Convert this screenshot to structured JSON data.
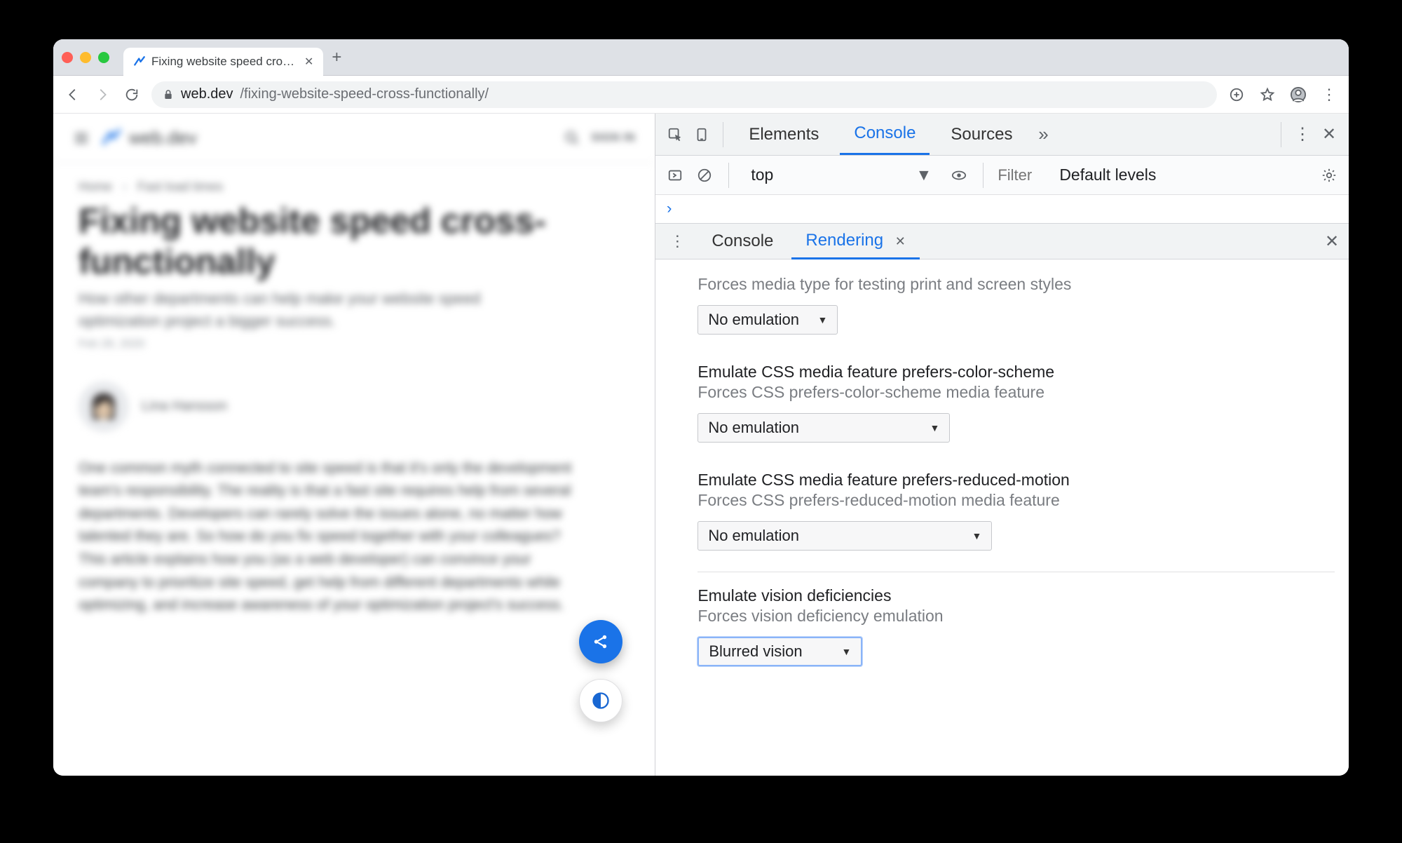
{
  "browser": {
    "tab_title": "Fixing website speed cross-fun",
    "url_host": "web.dev",
    "url_path": "/fixing-website-speed-cross-functionally/"
  },
  "page": {
    "brand": "web.dev",
    "sign_in": "SIGN IN",
    "crumbs": {
      "home": "Home",
      "section": "Fast load times"
    },
    "title": "Fixing website speed cross-functionally",
    "subtitle": "How other departments can help make your website speed optimization project a bigger success.",
    "date": "Feb 28, 2020",
    "author": "Lina Hansson",
    "body": "One common myth connected to site speed is that it's only the development team's responsibility. The reality is that a fast site requires help from several departments. Developers can rarely solve the issues alone, no matter how talented they are. So how do you fix speed together with your colleagues? This article explains how you (as a web developer) can convince your company to prioritize site speed, get help from different departments while optimizing, and increase awareness of your optimization project's success."
  },
  "devtools": {
    "tabs": {
      "elements": "Elements",
      "console": "Console",
      "sources": "Sources"
    },
    "context": "top",
    "filter_placeholder": "Filter",
    "levels": "Default levels ",
    "drawer": {
      "console": "Console",
      "rendering": "Rendering"
    },
    "rendering": {
      "media_type_desc": "Forces media type for testing print and screen styles",
      "no_emulation": "No emulation",
      "color_scheme_label": "Emulate CSS media feature prefers-color-scheme",
      "color_scheme_desc": "Forces CSS prefers-color-scheme media feature",
      "reduced_motion_label": "Emulate CSS media feature prefers-reduced-motion",
      "reduced_motion_desc": "Forces CSS prefers-reduced-motion media feature",
      "vision_label": "Emulate vision deficiencies",
      "vision_desc": "Forces vision deficiency emulation",
      "vision_value": "Blurred vision"
    }
  }
}
